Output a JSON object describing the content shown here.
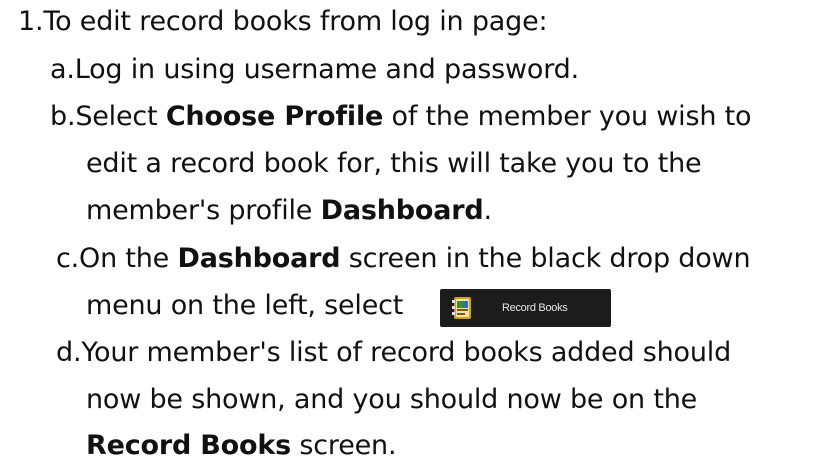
{
  "instructions": {
    "step1": {
      "marker": "1.",
      "text": "To edit record books from log in page:"
    },
    "a": {
      "marker": "a.",
      "text": "Log in using username and password."
    },
    "b": {
      "marker": "b.",
      "pre": "Select ",
      "bold": "Choose Profile",
      "post": " of the member you wish to",
      "line2": "edit a record book for, this will take you to the",
      "line3_pre": "member's profile ",
      "line3_bold": "Dashboard",
      "line3_post": "."
    },
    "c": {
      "marker": "c.",
      "pre": "On the ",
      "bold": "Dashboard",
      "post": " screen in the black drop down",
      "line2": "menu on the left, select"
    },
    "d": {
      "marker": "d.",
      "text": "Your member's list of record books added should",
      "line2": "now be shown, and you should now be on the",
      "line3_bold": "Record Books",
      "line3_post": " screen."
    }
  },
  "record_books_button": {
    "label": "Record Books",
    "icon": "record-book-icon",
    "background": "#1c1c1c"
  }
}
